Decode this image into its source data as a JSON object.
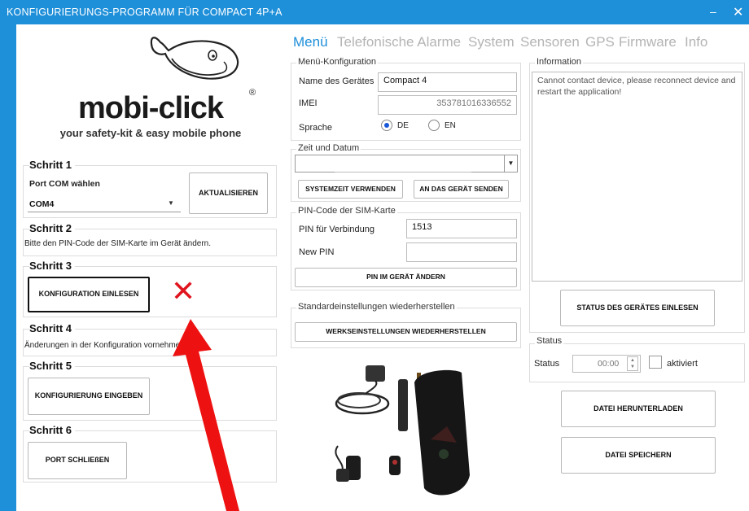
{
  "window": {
    "title": "KONFIGURIERUNGS-PROGRAMM FÜR COMPACT 4P+A",
    "minimize": "–",
    "close": "✕"
  },
  "logo": {
    "brand": "mobi-click",
    "registered": "®",
    "tagline": "your safety-kit & easy mobile phone"
  },
  "steps": {
    "s1": {
      "title": "Schritt 1",
      "label": "Port COM wählen",
      "port": "COM4",
      "refresh": "AKTUALISIEREN"
    },
    "s2": {
      "title": "Schritt 2",
      "text": "Bitte den PIN-Code der SIM-Karte im Gerät ändern."
    },
    "s3": {
      "title": "Schritt 3",
      "button": "KONFIGURATION EINLESEN"
    },
    "s4": {
      "title": "Schritt 4",
      "text": "Änderungen in der Konfiguration vornehmen"
    },
    "s5": {
      "title": "Schritt 5",
      "button": "KONFIGURIERUNG EINGEBEN"
    },
    "s6": {
      "title": "Schritt 6",
      "button": "PORT SCHLIEßEN"
    }
  },
  "tabs": [
    "Menü",
    "Telefonische Alarme",
    "System",
    "Sensoren",
    "GPS",
    "Firmware",
    "Info"
  ],
  "menu_config": {
    "legend": "Menü-Konfiguration",
    "name_label": "Name des Gerätes",
    "name_value": "Compact 4",
    "imei_label": "IMEI",
    "imei_value": "353781016336552",
    "lang_label": "Sprache",
    "lang_de": "DE",
    "lang_en": "EN"
  },
  "datetime": {
    "legend": "Zeit und Datum",
    "btn_system": "SYSTEMZEIT VERWENDEN",
    "btn_send": "AN DAS GERÄT SENDEN"
  },
  "pin": {
    "legend": "PIN-Code der SIM-Karte",
    "pin_label": "PIN für Verbindung",
    "pin_value": "1513",
    "new_label": "New PIN",
    "new_value": "",
    "btn_change": "PIN IM GERÄT ÄNDERN"
  },
  "reset": {
    "legend": "Standardeinstellungen wiederherstellen",
    "button": "WERKSEINSTELLUNGEN WIEDERHERSTELLEN"
  },
  "information": {
    "legend": "Information",
    "text": "Cannot contact device, please reconnect device and restart the application!",
    "btn_status": "STATUS DES GERÄTES EINLESEN"
  },
  "status": {
    "legend": "Status",
    "label": "Status",
    "time": "00:00",
    "activated": "aktiviert"
  },
  "files": {
    "download": "DATEI HERUNTERLADEN",
    "save": "DATEI SPEICHERN"
  },
  "annotation": {
    "x_mark": "✕",
    "x_color": "#e0141e",
    "arrow_color": "#ee1111"
  }
}
